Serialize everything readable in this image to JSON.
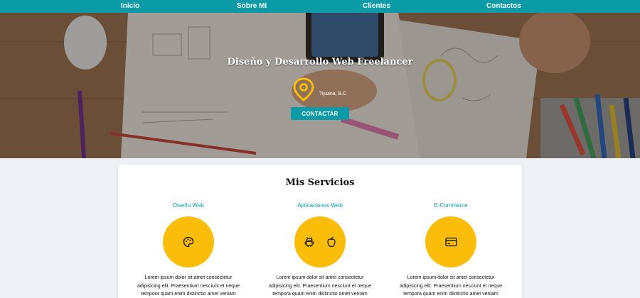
{
  "nav": {
    "items": [
      {
        "label": "Inicio"
      },
      {
        "label": "Sobre Mi"
      },
      {
        "label": "Clientes"
      },
      {
        "label": "Contactos"
      }
    ]
  },
  "hero": {
    "title": "Diseño y Desarrollo Web Freelancer",
    "location": "Tijuana, B.C",
    "location_icon": "location-pin-icon",
    "cta_label": "CONTACTAR"
  },
  "services": {
    "title": "Mis Servicios",
    "items": [
      {
        "name": "Diseño Web",
        "icon": "palette-icon",
        "text": "Lorem ipsum dolor sit amet consectetur adipisicing elit. Praesentium nesciunt et neque tempora quam enim distinctio amet veniam"
      },
      {
        "name": "Aplicaciones Web",
        "icon": "android-icon, apple-icon",
        "text": "Lorem ipsum dolor sit amet consectetur adipisicing elit. Praesentium nesciunt et neque tempora quam enim distinctio amet veniam"
      },
      {
        "name": "E-Commerce",
        "icon": "credit-card-icon",
        "text": "Lorem ipsum dolor sit amet consectetur adipisicing elit. Praesentium nesciunt et neque tempora quam enim distinctio amet veniam"
      }
    ]
  },
  "colors": {
    "nav_bg": "#0a9ba6",
    "accent_yellow": "#f9bd0a",
    "link_teal": "#0a9ba6"
  }
}
